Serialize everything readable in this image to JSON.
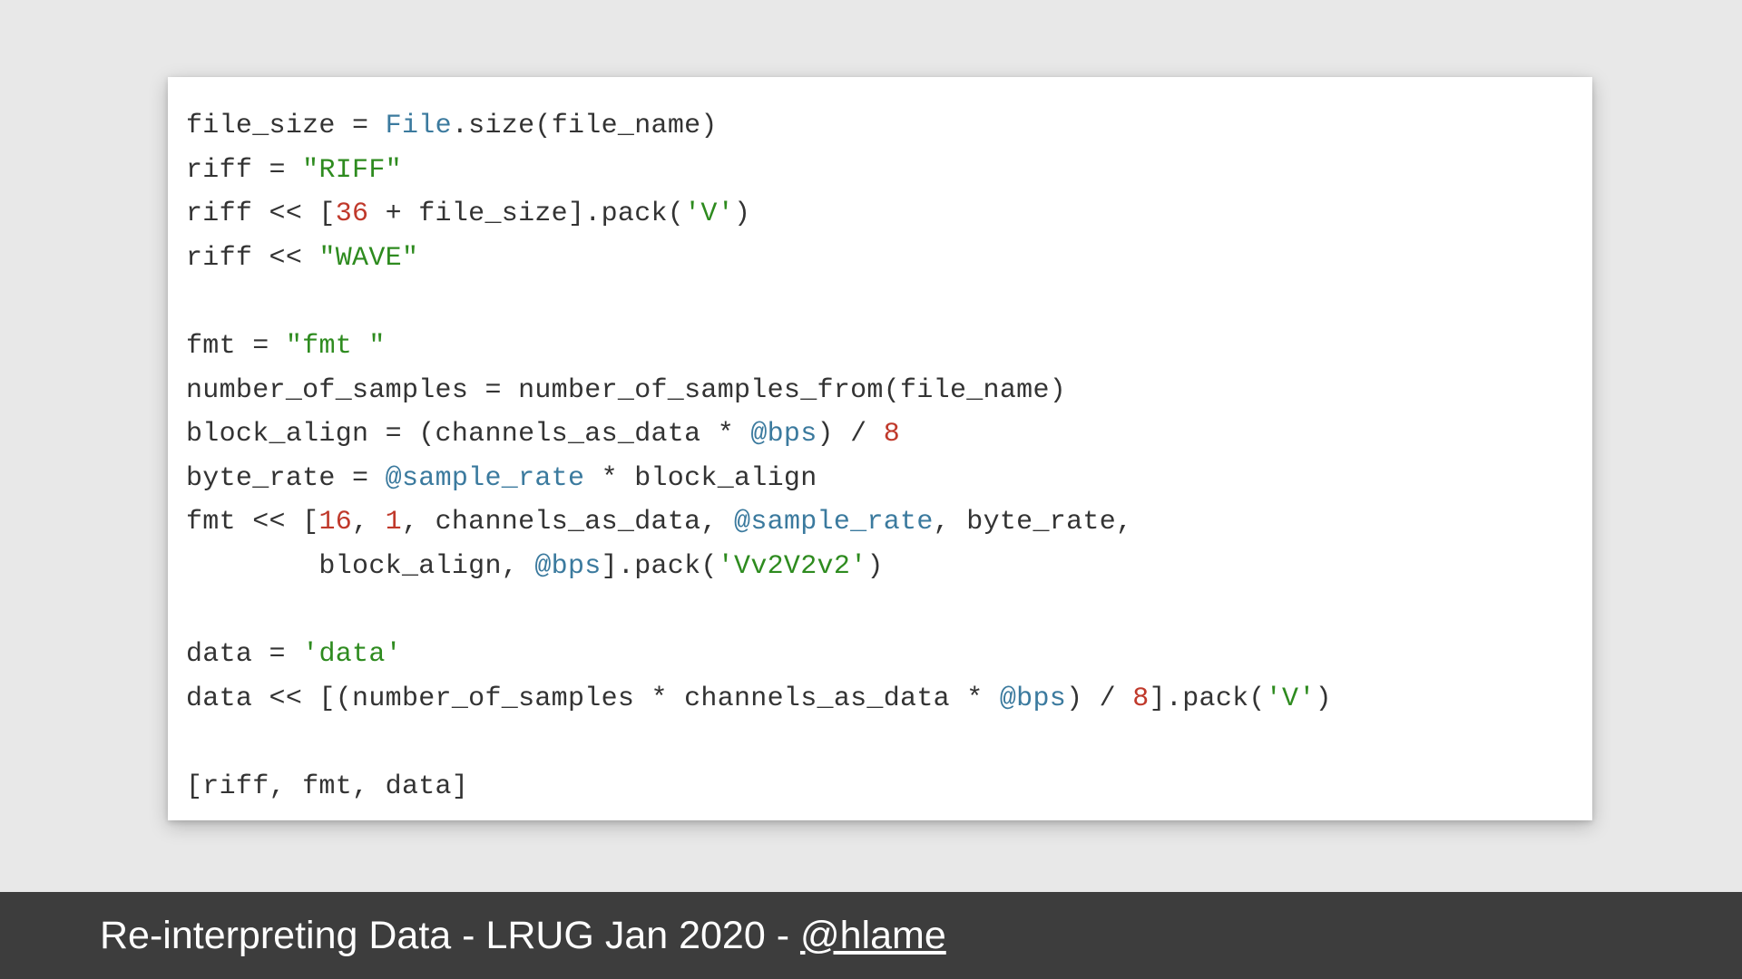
{
  "code": {
    "l1_a": "file_size ",
    "l1_op": "=",
    "l1_b": " ",
    "l1_const": "File",
    "l1_c": ".size(file_name)",
    "l2_a": "riff ",
    "l2_op": "=",
    "l2_b": " ",
    "l2_str": "\"RIFF\"",
    "l3_a": "riff ",
    "l3_op": "<<",
    "l3_b": " [",
    "l3_num": "36",
    "l3_c": " + file_size].pack(",
    "l3_str": "'V'",
    "l3_d": ")",
    "l4_a": "riff ",
    "l4_op": "<<",
    "l4_b": " ",
    "l4_str": "\"WAVE\"",
    "l6_a": "fmt ",
    "l6_op": "=",
    "l6_b": " ",
    "l6_str": "\"fmt \"",
    "l7_a": "number_of_samples ",
    "l7_op": "=",
    "l7_b": " number_of_samples_from(file_name)",
    "l8_a": "block_align ",
    "l8_op": "=",
    "l8_b": " (channels_as_data * ",
    "l8_ivar": "@bps",
    "l8_c": ") / ",
    "l8_num": "8",
    "l9_a": "byte_rate ",
    "l9_op": "=",
    "l9_b": " ",
    "l9_ivar": "@sample_rate",
    "l9_c": " * block_align",
    "l10_a": "fmt ",
    "l10_op": "<<",
    "l10_b": " [",
    "l10_num1": "16",
    "l10_c": ", ",
    "l10_num2": "1",
    "l10_d": ", channels_as_data, ",
    "l10_ivar": "@sample_rate",
    "l10_e": ", byte_rate,",
    "l11_a": "        block_align, ",
    "l11_ivar": "@bps",
    "l11_b": "].pack(",
    "l11_str": "'Vv2V2v2'",
    "l11_c": ")",
    "l13_a": "data ",
    "l13_op": "=",
    "l13_b": " ",
    "l13_str": "'data'",
    "l14_a": "data ",
    "l14_op": "<<",
    "l14_b": " [(number_of_samples * channels_as_data * ",
    "l14_ivar": "@bps",
    "l14_c": ") / ",
    "l14_num": "8",
    "l14_d": "].pack(",
    "l14_str": "'V'",
    "l14_e": ")",
    "l16": "[riff, fmt, data]"
  },
  "footer": {
    "prefix": "Re-interpreting Data - LRUG Jan 2020 - ",
    "handle": "@hlame"
  }
}
